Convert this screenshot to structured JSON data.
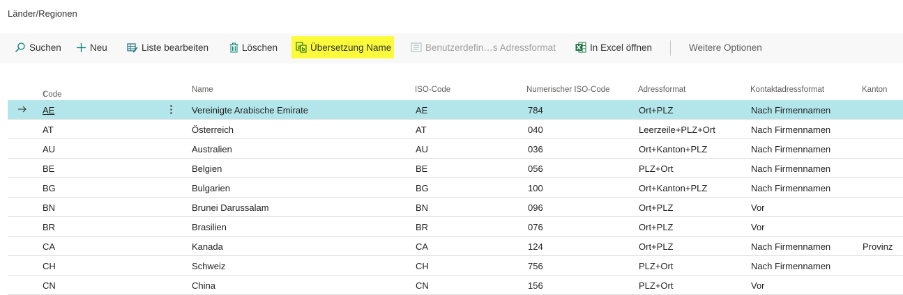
{
  "page": {
    "title": "Länder/Regionen"
  },
  "toolbar": {
    "search": "Suchen",
    "new": "Neu",
    "edit_list": "Liste bearbeiten",
    "delete": "Löschen",
    "translation": "Übersetzung Name",
    "custom_address": "Benutzerdefin…s Adressformat",
    "excel": "In Excel öffnen",
    "more": "Weitere Optionen"
  },
  "columns": {
    "code": "Code",
    "code_sort": "↑",
    "name": "Name",
    "iso": "ISO-Code",
    "numeric_iso": "Numerischer ISO-Code",
    "address_format": "Adressformat",
    "contact_format": "Kontaktadressformat",
    "canton": "Kanton"
  },
  "rows": [
    {
      "code": "AE",
      "name": "Vereinigte Arabische Emirate",
      "iso": "AE",
      "num": "784",
      "addr": "Ort+PLZ",
      "contact": "Nach Firmennamen",
      "canton": ""
    },
    {
      "code": "AT",
      "name": "Österreich",
      "iso": "AT",
      "num": "040",
      "addr": "Leerzeile+PLZ+Ort",
      "contact": "Nach Firmennamen",
      "canton": ""
    },
    {
      "code": "AU",
      "name": "Australien",
      "iso": "AU",
      "num": "036",
      "addr": "Ort+Kanton+PLZ",
      "contact": "Nach Firmennamen",
      "canton": ""
    },
    {
      "code": "BE",
      "name": "Belgien",
      "iso": "BE",
      "num": "056",
      "addr": "PLZ+Ort",
      "contact": "Nach Firmennamen",
      "canton": ""
    },
    {
      "code": "BG",
      "name": "Bulgarien",
      "iso": "BG",
      "num": "100",
      "addr": "Ort+Kanton+PLZ",
      "contact": "Nach Firmennamen",
      "canton": ""
    },
    {
      "code": "BN",
      "name": "Brunei Darussalam",
      "iso": "BN",
      "num": "096",
      "addr": "Ort+PLZ",
      "contact": "Vor",
      "canton": ""
    },
    {
      "code": "BR",
      "name": "Brasilien",
      "iso": "BR",
      "num": "076",
      "addr": "Ort+PLZ",
      "contact": "Vor",
      "canton": ""
    },
    {
      "code": "CA",
      "name": "Kanada",
      "iso": "CA",
      "num": "124",
      "addr": "Ort+PLZ",
      "contact": "Nach Firmennamen",
      "canton": "Provinz"
    },
    {
      "code": "CH",
      "name": "Schweiz",
      "iso": "CH",
      "num": "756",
      "addr": "PLZ+Ort",
      "contact": "Nach Firmennamen",
      "canton": ""
    },
    {
      "code": "CN",
      "name": "China",
      "iso": "CN",
      "num": "156",
      "addr": "PLZ+Ort",
      "contact": "Vor",
      "canton": ""
    }
  ],
  "selected_row": 0,
  "colors": {
    "selected_row_bg": "#b3e6ea",
    "highlight": "#fbfb3c",
    "accent": "#00857a"
  }
}
